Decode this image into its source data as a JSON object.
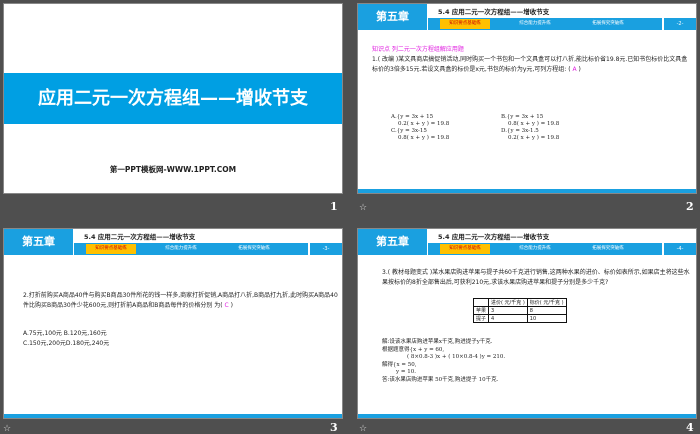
{
  "slides": [
    {
      "number": "1",
      "title": "应用二元一次方程组——增收节支",
      "subtitle": "第一PPT模板网-WWW.1PPT.COM"
    },
    {
      "number": "2",
      "chapter": "第五章",
      "section_title": "5.4  应用二元一次方程组——增收节支",
      "tabs": [
        "知识要点基础练",
        "综合能力提升练",
        "拓展探究突破练"
      ],
      "page": "-2-",
      "heading": "知识点    列二元一次方程组解应用题",
      "question": "1.( 改编 )某文具商店搞促销活动,同时购买一个书包和一个文具盒可以打八折,能比标价省19.8元.已知书包标价比文具盒标价的3倍多15元.若设文具盒的标价是x元,书包的标价为y元,可列方程组: (",
      "answer": "A",
      "close": ")",
      "options": [
        {
          "label": "A.",
          "l1": "y = 3x + 15",
          "l2": "0.2( x + y ) = 19.8"
        },
        {
          "label": "B.",
          "l1": "y = 3x + 15",
          "l2": "0.8( x + y ) = 19.8"
        },
        {
          "label": "C.",
          "l1": "y = 3x-15",
          "l2": "0.8( x + y ) = 19.8"
        },
        {
          "label": "D.",
          "l1": "y = 3x-1.5",
          "l2": "0.2( x + y ) = 19.8"
        }
      ]
    },
    {
      "number": "3",
      "chapter": "第五章",
      "section_title": "5.4  应用二元一次方程组——增收节支",
      "tabs": [
        "知识要点基础练",
        "综合能力提升练",
        "拓展探究突破练"
      ],
      "page": "-3-",
      "question": "2.打折前购买A商品40件与购买B商品30件所花的钱一样多,商家打折促销,A商品打八折,B商品打九折,此时购买A商品40件比购买B商品30件少花600元,则打折前A商品和B商品每件的价格分别  为(",
      "answer": "C",
      "close": ")",
      "opt1": "A.75元,100元  B.120元,160元",
      "opt2": "C.150元,200元D.180元,240元"
    },
    {
      "number": "4",
      "chapter": "第五章",
      "section_title": "5.4  应用二元一次方程组——增收节支",
      "tabs": [
        "知识要点基础练",
        "综合能力提升练",
        "拓展探究突破练"
      ],
      "page": "-4-",
      "question": "3.( 教材母题变式 )某水果店购进苹果与提子共60千克进行销售,这两种水果的进价、标价如表所示,如果店主将这些水果按标价的8折全部售出后,可获利210元,求该水果店购进苹果和提子分别是多少千克?",
      "table": {
        "headers": [
          "",
          "进价( 元/千克 )",
          "标价( 元/千克 )"
        ],
        "rows": [
          [
            "苹果",
            "3",
            "8"
          ],
          [
            "提子",
            "4",
            "10"
          ]
        ]
      },
      "solution": [
        "解:设该水果店购进苹果x千克,购进提子y千克.",
        "根据题意得",
        "x + y = 60,",
        "( 8×0.8-3 )x + ( 10×0.8-4 )y = 210.",
        "解得",
        "x = 50,",
        "y = 10.",
        "答:该水果店购进苹果 50千克,购进提子 10千克."
      ]
    }
  ],
  "transition_icon": "☆"
}
